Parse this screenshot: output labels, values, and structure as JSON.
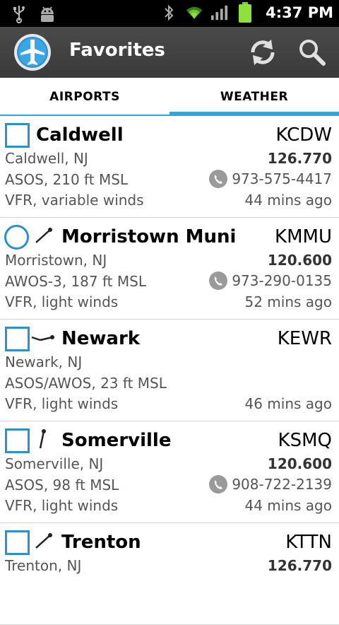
{
  "status_bar": {
    "time": "4:37 PM",
    "left_icons": [
      "usb-icon",
      "android-debug-icon"
    ],
    "right_icons": [
      "bluetooth-icon",
      "wifi-icon",
      "signal-icon",
      "battery-icon"
    ]
  },
  "action_bar": {
    "title": "Favorites",
    "logo_icon": "airplane-logo-icon",
    "refresh_icon": "refresh-icon",
    "search_icon": "search-icon"
  },
  "tabs": {
    "items": [
      {
        "label": "AIRPORTS",
        "selected": false
      },
      {
        "label": "WEATHER",
        "selected": true
      }
    ]
  },
  "airports": [
    {
      "name": "Caldwell",
      "code": "KCDW",
      "location": "Caldwell, NJ",
      "frequency": "126.770",
      "station": "ASOS, 210 ft MSL",
      "phone": "973-575-4417",
      "conditions": "VFR, variable winds",
      "age": "44 mins ago",
      "marker": "checkbox",
      "runway_icon": ""
    },
    {
      "name": "Morristown Muni",
      "code": "KMMU",
      "location": "Morristown, NJ",
      "frequency": "120.600",
      "station": "AWOS-3, 187 ft MSL",
      "phone": "973-290-0135",
      "conditions": "VFR, light winds",
      "age": "52 mins ago",
      "marker": "circle",
      "runway_icon": "runway-diagonal-icon"
    },
    {
      "name": "Newark",
      "code": "KEWR",
      "location": "Newark, NJ",
      "frequency": "",
      "station": "ASOS/AWOS, 23 ft MSL",
      "phone": "",
      "conditions": "VFR, light winds",
      "age": "46 mins ago",
      "marker": "checkbox",
      "runway_icon": "runway-horizontal-icon"
    },
    {
      "name": "Somerville",
      "code": "KSMQ",
      "location": "Somerville, NJ",
      "frequency": "120.600",
      "station": "ASOS, 98 ft MSL",
      "phone": "908-722-2139",
      "conditions": "VFR, light winds",
      "age": "44 mins ago",
      "marker": "checkbox",
      "runway_icon": "runway-vertical-icon"
    },
    {
      "name": "Trenton",
      "code": "KTTN",
      "location": "Trenton, NJ",
      "frequency": "126.770",
      "station": "",
      "phone": "",
      "conditions": "",
      "age": "",
      "marker": "checkbox",
      "runway_icon": "runway-diagonal-icon"
    }
  ],
  "colors": {
    "accent": "#32a5d9",
    "checkbox": "#2c8fcf",
    "action_bar": "#424242"
  }
}
